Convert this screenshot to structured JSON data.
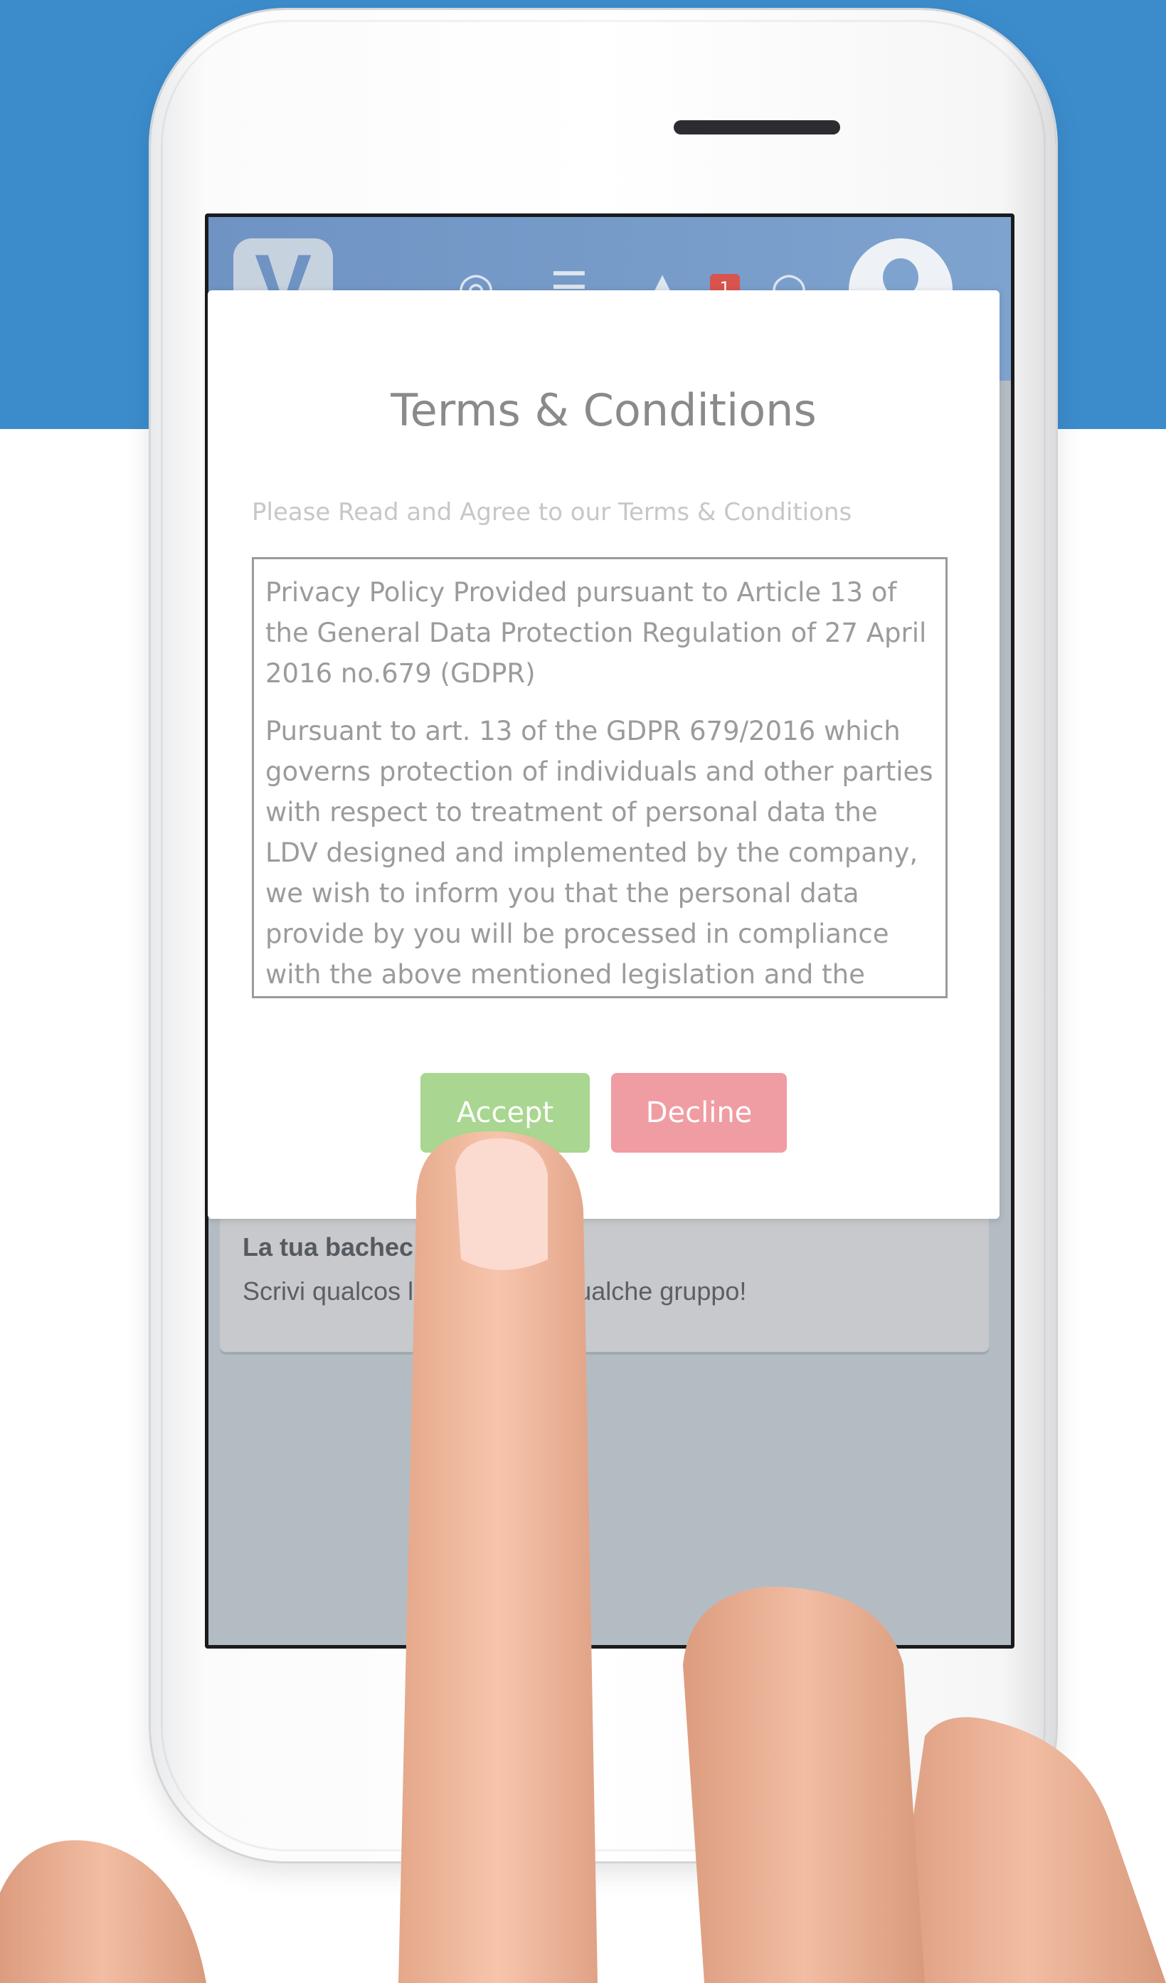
{
  "app": {
    "notification_count": "1",
    "icons": [
      "logo-icon",
      "location-icon",
      "menu-icon",
      "bell-icon",
      "search-icon",
      "avatar"
    ]
  },
  "wall": {
    "title": "La tua bachec",
    "text": "Scrivi qualcos              lo o unisciti a qualche gruppo!"
  },
  "modal": {
    "title": "Terms & Conditions",
    "subtitle": "Please Read and Agree to our Terms & Conditions",
    "terms": {
      "paragraph_1": "Privacy Policy Provided pursuant to Article 13 of the General Data Protection Regulation of 27 April 2016 no.679 (GDPR)",
      "paragraph_2": "Pursuant to art. 13 of the GDPR 679/2016 which governs protection of individuals and other parties with respect to treatment of personal data the LDV designed and implemented by the company, we wish to inform you that the personal data provide by you will be processed in compliance with the above mentioned legislation and the secrecy obligations"
    },
    "accept_label": "Accept",
    "decline_label": "Decline"
  },
  "colors": {
    "background_blue": "#3c8ccc",
    "accept": "#a9d690",
    "decline": "#f09ca3",
    "badge": "#d9534f"
  }
}
